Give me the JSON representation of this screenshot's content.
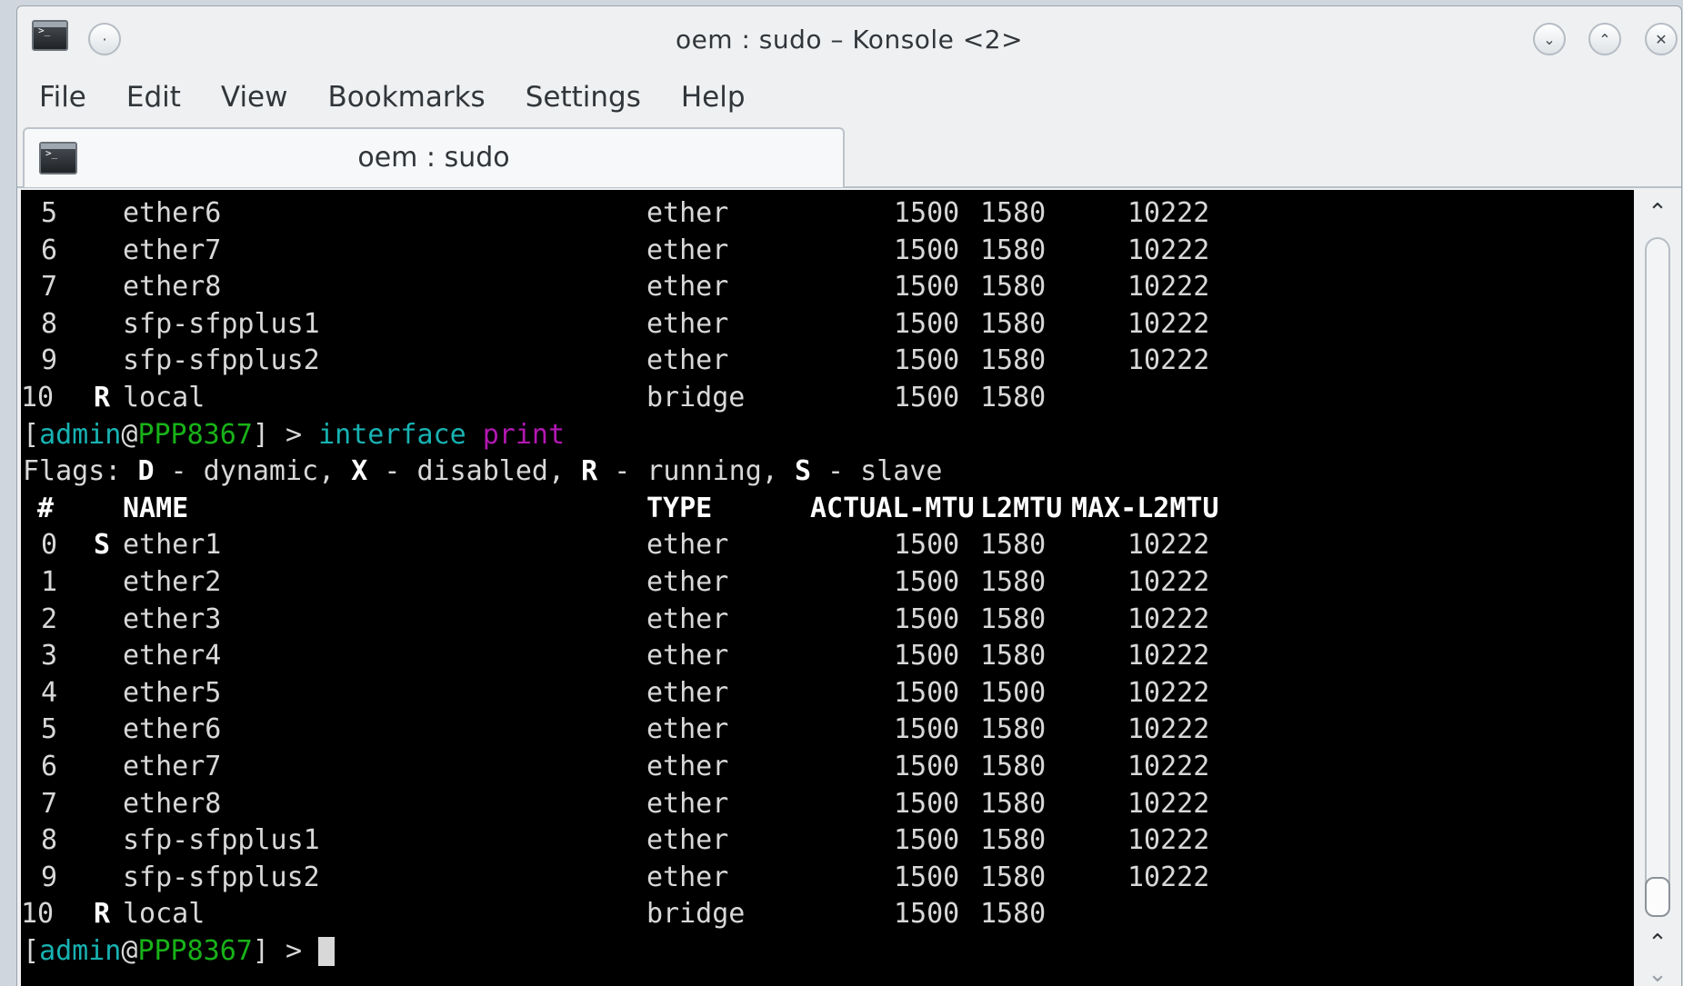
{
  "window": {
    "title": "oem : sudo – Konsole <2>",
    "icons": [
      "terminal-app-icon",
      "pin-icon",
      "minimize-icon",
      "maximize-icon",
      "close-icon"
    ]
  },
  "menu": [
    "File",
    "Edit",
    "View",
    "Bookmarks",
    "Settings",
    "Help"
  ],
  "tab": {
    "label": "oem : sudo"
  },
  "colors": {
    "prompt_user": "#18b2b2",
    "prompt_host": "#18b218",
    "command_arg": "#b218b2",
    "terminal_bg": "#000000",
    "terminal_fg": "#d8d8d8"
  },
  "terminal": {
    "rows_top": [
      {
        "num": "5",
        "flag": "",
        "name": "ether6",
        "type": "ether",
        "actual_mtu": "1500",
        "l2mtu": "1580",
        "max_l2mtu": "10222"
      },
      {
        "num": "6",
        "flag": "",
        "name": "ether7",
        "type": "ether",
        "actual_mtu": "1500",
        "l2mtu": "1580",
        "max_l2mtu": "10222"
      },
      {
        "num": "7",
        "flag": "",
        "name": "ether8",
        "type": "ether",
        "actual_mtu": "1500",
        "l2mtu": "1580",
        "max_l2mtu": "10222"
      },
      {
        "num": "8",
        "flag": "",
        "name": "sfp-sfpplus1",
        "type": "ether",
        "actual_mtu": "1500",
        "l2mtu": "1580",
        "max_l2mtu": "10222"
      },
      {
        "num": "9",
        "flag": "",
        "name": "sfp-sfpplus2",
        "type": "ether",
        "actual_mtu": "1500",
        "l2mtu": "1580",
        "max_l2mtu": "10222"
      },
      {
        "num": "10",
        "flag": "R",
        "name": "local",
        "type": "bridge",
        "actual_mtu": "1500",
        "l2mtu": "1580",
        "max_l2mtu": ""
      }
    ],
    "prompt": {
      "open": "[",
      "user": "admin",
      "at": "@",
      "host": "PPP8367",
      "close": "] >"
    },
    "command": {
      "cmd": "interface",
      "arg": "print"
    },
    "flags_line": {
      "label": "Flags:",
      "items": [
        {
          "key": "D",
          "desc": "- dynamic,"
        },
        {
          "key": "X",
          "desc": "- disabled,"
        },
        {
          "key": "R",
          "desc": "- running,"
        },
        {
          "key": "S",
          "desc": "- slave"
        }
      ]
    },
    "headers": {
      "num": "#",
      "name": "NAME",
      "type": "TYPE",
      "actual_mtu": "ACTUAL-MTU",
      "l2mtu": "L2MTU",
      "max_l2mtu": "MAX-L2MTU"
    },
    "rows": [
      {
        "num": "0",
        "flag": "S",
        "name": "ether1",
        "type": "ether",
        "actual_mtu": "1500",
        "l2mtu": "1580",
        "max_l2mtu": "10222"
      },
      {
        "num": "1",
        "flag": "",
        "name": "ether2",
        "type": "ether",
        "actual_mtu": "1500",
        "l2mtu": "1580",
        "max_l2mtu": "10222"
      },
      {
        "num": "2",
        "flag": "",
        "name": "ether3",
        "type": "ether",
        "actual_mtu": "1500",
        "l2mtu": "1580",
        "max_l2mtu": "10222"
      },
      {
        "num": "3",
        "flag": "",
        "name": "ether4",
        "type": "ether",
        "actual_mtu": "1500",
        "l2mtu": "1580",
        "max_l2mtu": "10222"
      },
      {
        "num": "4",
        "flag": "",
        "name": "ether5",
        "type": "ether",
        "actual_mtu": "1500",
        "l2mtu": "1500",
        "max_l2mtu": "10222"
      },
      {
        "num": "5",
        "flag": "",
        "name": "ether6",
        "type": "ether",
        "actual_mtu": "1500",
        "l2mtu": "1580",
        "max_l2mtu": "10222"
      },
      {
        "num": "6",
        "flag": "",
        "name": "ether7",
        "type": "ether",
        "actual_mtu": "1500",
        "l2mtu": "1580",
        "max_l2mtu": "10222"
      },
      {
        "num": "7",
        "flag": "",
        "name": "ether8",
        "type": "ether",
        "actual_mtu": "1500",
        "l2mtu": "1580",
        "max_l2mtu": "10222"
      },
      {
        "num": "8",
        "flag": "",
        "name": "sfp-sfpplus1",
        "type": "ether",
        "actual_mtu": "1500",
        "l2mtu": "1580",
        "max_l2mtu": "10222"
      },
      {
        "num": "9",
        "flag": "",
        "name": "sfp-sfpplus2",
        "type": "ether",
        "actual_mtu": "1500",
        "l2mtu": "1580",
        "max_l2mtu": "10222"
      },
      {
        "num": "10",
        "flag": "R",
        "name": "local",
        "type": "bridge",
        "actual_mtu": "1500",
        "l2mtu": "1580",
        "max_l2mtu": ""
      }
    ]
  }
}
